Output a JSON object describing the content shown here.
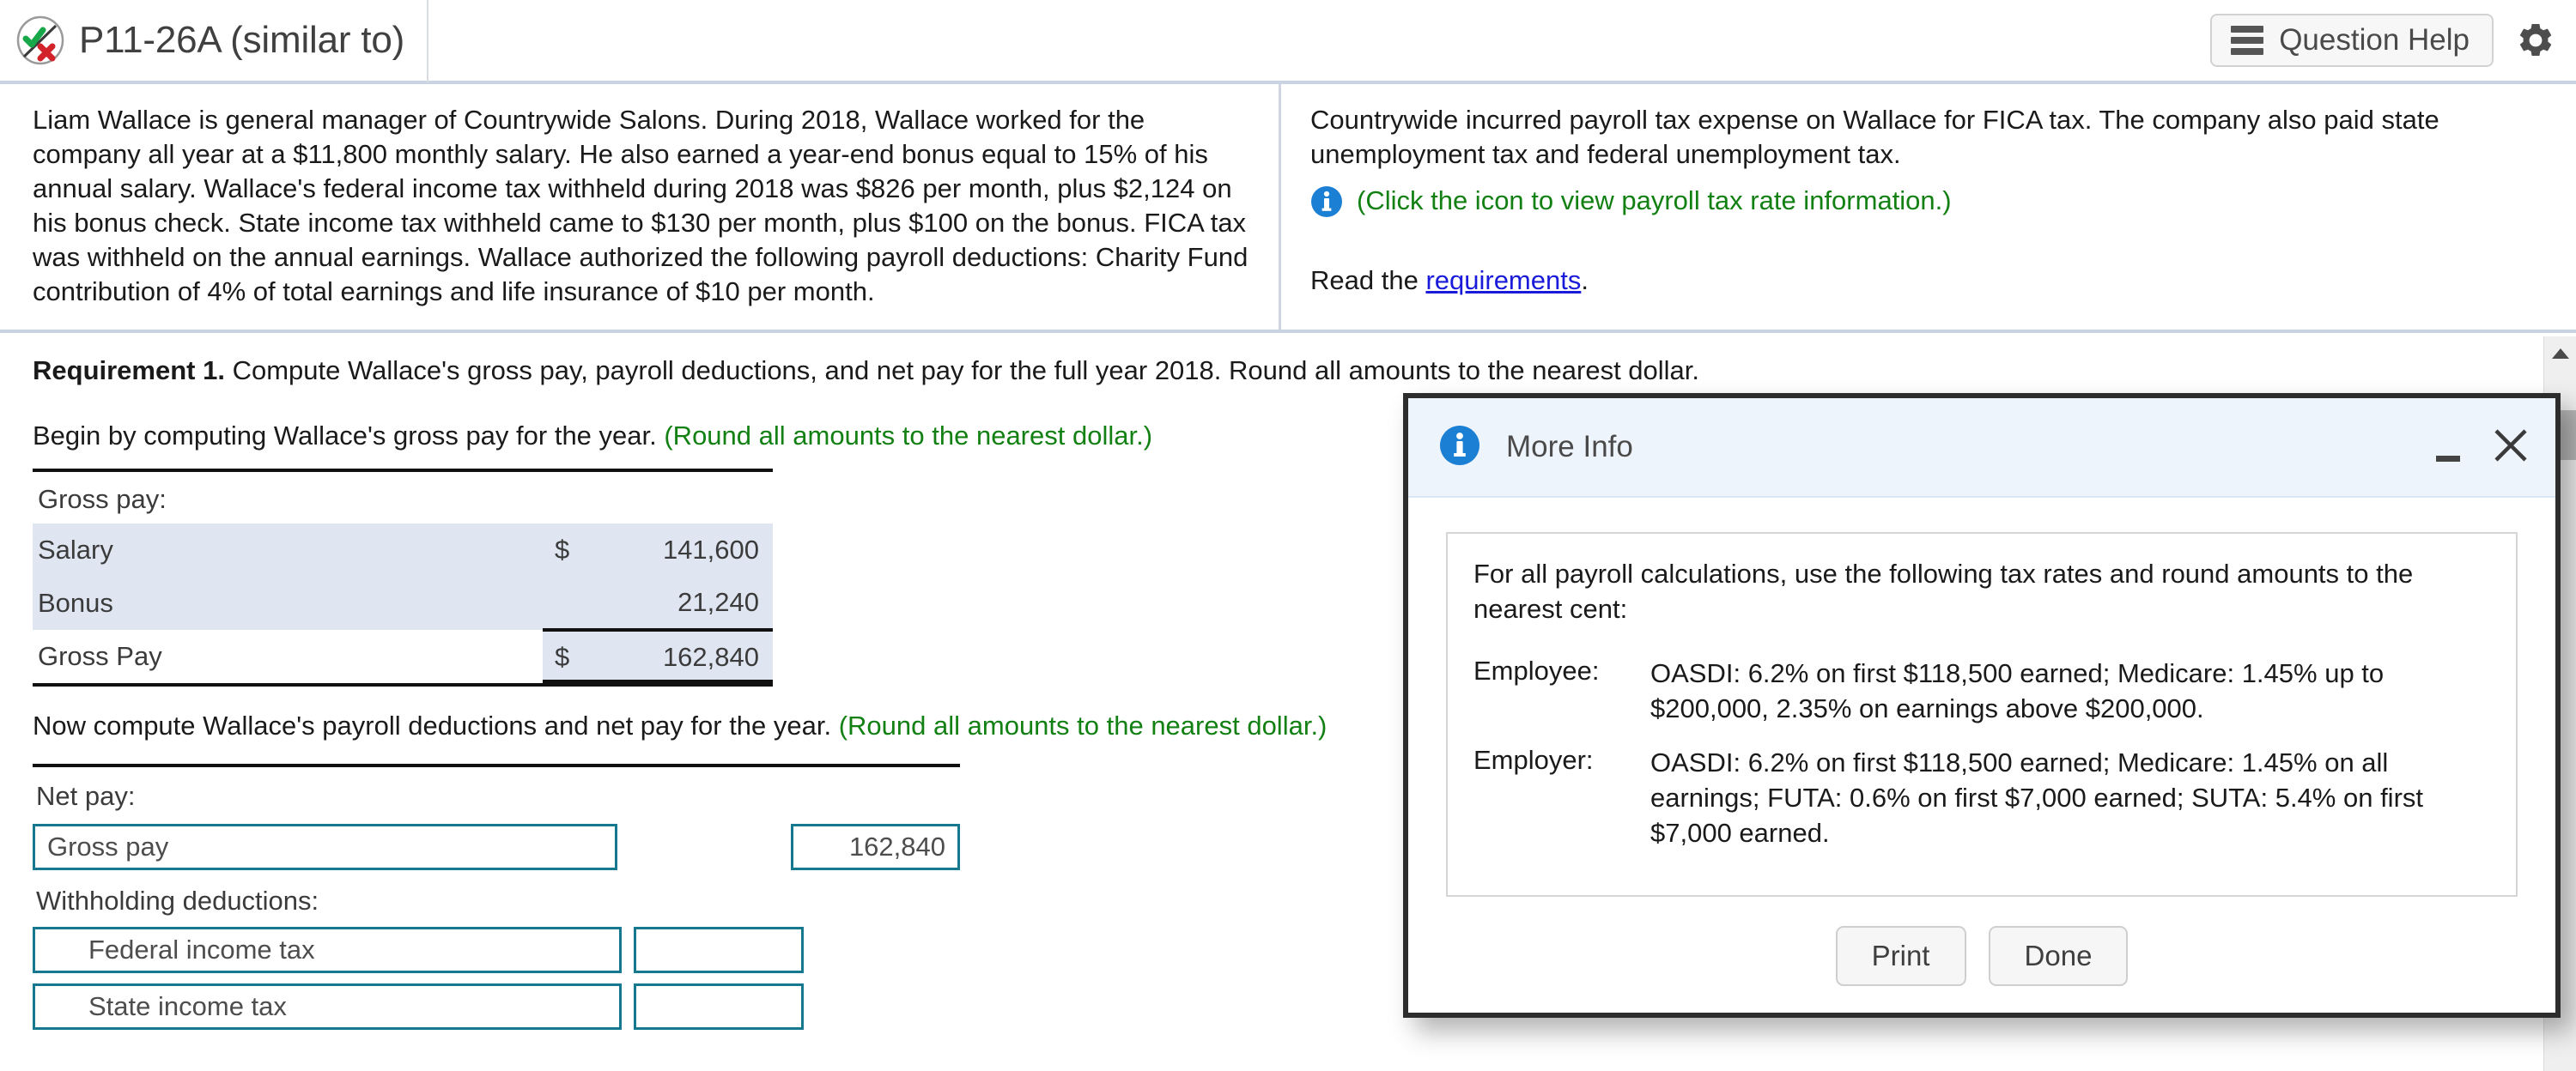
{
  "header": {
    "title": "P11-26A (similar to)",
    "question_help_label": "Question Help",
    "icon_check_x": "check-x-icon",
    "settings_icon": "gear-icon"
  },
  "statement": {
    "left_paragraph": "Liam Wallace is general manager of Countrywide Salons. During 2018, Wallace worked for the company all year at a $11,800 monthly salary. He also earned a year-end bonus equal to 15% of his annual salary. Wallace's federal income tax withheld during 2018 was $826 per month, plus $2,124 on his bonus check. State income tax withheld came to $130 per month, plus $100 on the bonus. FICA tax was withheld on the annual earnings. Wallace authorized the following payroll deductions: Charity Fund contribution of 4% of total earnings and life insurance of $10 per month.",
    "right_paragraph": "Countrywide incurred payroll tax expense on Wallace for FICA tax. The company also paid state unemployment tax and federal unemployment tax.",
    "info_link_text": "(Click the icon to view payroll tax rate information.)",
    "read_prefix": "Read the ",
    "read_link": "requirements",
    "read_suffix": "."
  },
  "work": {
    "requirement_label": "Requirement 1.",
    "requirement_text": " Compute Wallace's gross pay, payroll deductions, and net pay for the full year 2018. Round all amounts to the nearest dollar.",
    "begin_text": "Begin by computing Wallace's gross pay for the year. ",
    "begin_hint": "(Round all amounts to the nearest dollar.)",
    "gross_pay_caption": "Gross pay:",
    "gross_rows": [
      {
        "name": "Salary",
        "currency": "$",
        "amount": "141,600"
      },
      {
        "name": "Bonus",
        "currency": "",
        "amount": "21,240"
      },
      {
        "name": "Gross Pay",
        "currency": "$",
        "amount": "162,840"
      }
    ],
    "now_text": "Now compute Wallace's payroll deductions and net pay for the year. ",
    "now_hint": "(Round all amounts to the nearest dollar.)",
    "net_pay_caption": "Net pay:",
    "net_rows": [
      {
        "name": "Gross pay",
        "amount": "162,840",
        "indent": false
      },
      {
        "name": "Withholding deductions:",
        "amount": "",
        "indent": false
      },
      {
        "name": "Federal income tax",
        "amount": "",
        "indent": true
      },
      {
        "name": "State income tax",
        "amount": "",
        "indent": true
      }
    ]
  },
  "modal": {
    "title": "More Info",
    "info_icon": "info-icon",
    "minimize_label": "minimize-icon",
    "close_label": "close-icon",
    "intro": "For all payroll calculations, use the following tax rates and round amounts to the nearest cent:",
    "rows": [
      {
        "key": "Employee:",
        "value": "OASDI: 6.2% on first $118,500 earned; Medicare: 1.45% up to $200,000, 2.35% on earnings above $200,000."
      },
      {
        "key": "Employer:",
        "value": "OASDI: 6.2% on first $118,500 earned; Medicare: 1.45% on all earnings; FUTA: 0.6% on first $7,000 earned; SUTA: 5.4% on first $7,000 earned."
      }
    ],
    "print_label": "Print",
    "done_label": "Done"
  },
  "colors": {
    "accent_teal": "#16788f",
    "hint_green": "#128013",
    "link_blue": "#1a1adb",
    "info_blue": "#1b7fd4",
    "row_shade": "#dfe6f2",
    "divider": "#c9d4e3"
  }
}
